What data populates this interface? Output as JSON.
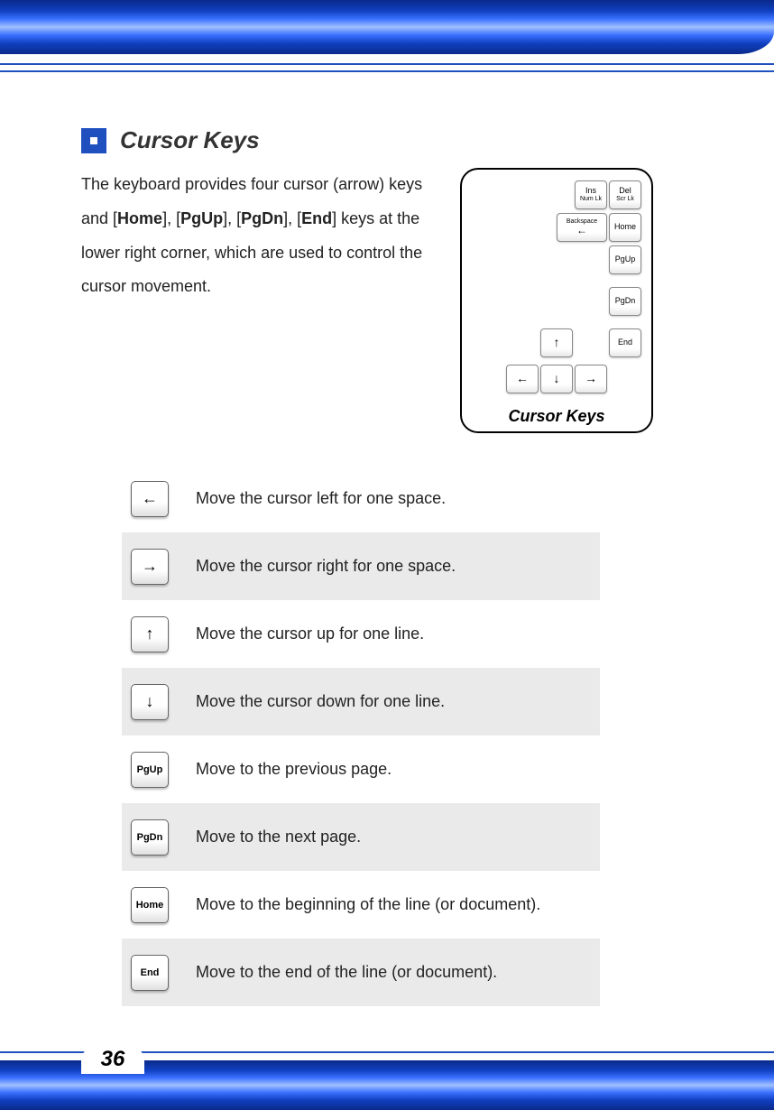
{
  "page_number": "36",
  "title": "Cursor Keys",
  "intro": {
    "pre": "The keyboard provides four cursor (arrow) keys and [",
    "key1": "Home",
    "mid1": "], [",
    "key2": "PgUp",
    "mid2": "], [",
    "key3": "PgDn",
    "mid3": "], [",
    "key4": "End",
    "post": "] keys at the lower right corner, which are used to control the cursor movement."
  },
  "diagram_caption": "Cursor Keys",
  "diagram_keys": {
    "ins_top": "Ins",
    "ins_bot": "Num Lk",
    "del_top": "Del",
    "del_bot": "Scr Lk",
    "backspace": "Backspace",
    "home": "Home",
    "pgup": "PgUp",
    "pgdn": "PgDn",
    "end": "End",
    "arrow_up": "↑",
    "arrow_left": "←",
    "arrow_down": "↓",
    "arrow_right": "→"
  },
  "rows": [
    {
      "glyph": "←",
      "arrow": true,
      "desc": "Move the cursor left for one space."
    },
    {
      "glyph": "→",
      "arrow": true,
      "desc": "Move the cursor right for one space."
    },
    {
      "glyph": "↑",
      "arrow": true,
      "desc": "Move the cursor up for one line."
    },
    {
      "glyph": "↓",
      "arrow": true,
      "desc": "Move the cursor down for one line."
    },
    {
      "glyph": "PgUp",
      "arrow": false,
      "desc": "Move to the previous page."
    },
    {
      "glyph": "PgDn",
      "arrow": false,
      "desc": "Move to the next page."
    },
    {
      "glyph": "Home",
      "arrow": false,
      "desc": "Move to the beginning of the line (or document)."
    },
    {
      "glyph": "End",
      "arrow": false,
      "desc": "Move to the end of the line (or document)."
    }
  ]
}
